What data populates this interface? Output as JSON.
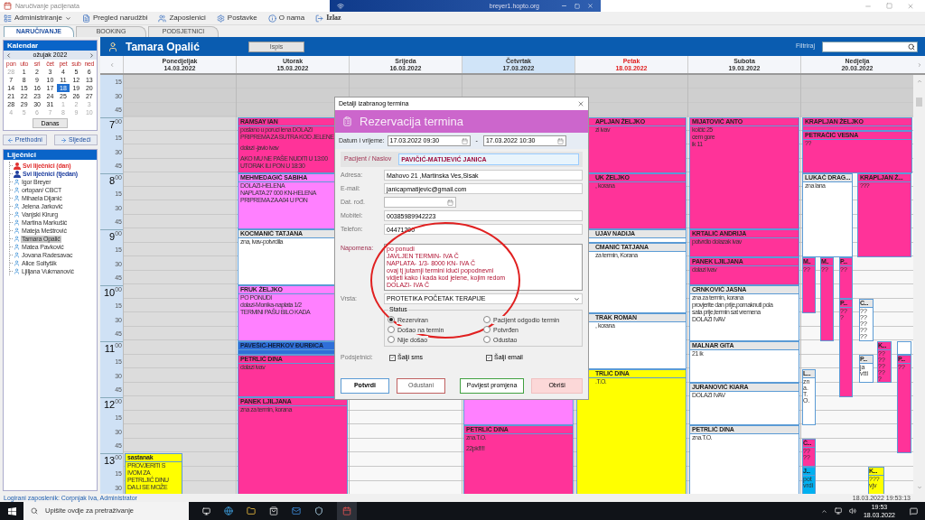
{
  "window": {
    "title": "Naručivanje pacijenata"
  },
  "remote_bar": {
    "host": "breyer1.hopto.org"
  },
  "menu": [
    {
      "label": "Administriranje",
      "kind": "dropdown"
    },
    {
      "label": "Pregled narudžbi",
      "kind": "orders"
    },
    {
      "label": "Zaposlenici",
      "kind": "staff"
    },
    {
      "label": "Postavke",
      "kind": "settings"
    },
    {
      "label": "O nama",
      "kind": "about"
    },
    {
      "label": "Izlaz",
      "kind": "exit"
    }
  ],
  "tabs": [
    {
      "label": "NARUČIVANJE",
      "selected": true
    },
    {
      "label": "BOOKING",
      "selected": false
    },
    {
      "label": "PODSJETNICI",
      "selected": false
    }
  ],
  "calendar": {
    "title": "Kalendar",
    "month": "ožujak 2022",
    "weekdays": [
      "pon",
      "uto",
      "sri",
      "čet",
      "pet",
      "sub",
      "ned"
    ],
    "today_button": "Danas",
    "days": [
      {
        "label": "28",
        "muted": true,
        "selected": false
      },
      {
        "label": "1",
        "muted": false,
        "selected": false
      },
      {
        "label": "2",
        "muted": false,
        "selected": false
      },
      {
        "label": "3",
        "muted": false,
        "selected": false
      },
      {
        "label": "4",
        "muted": false,
        "selected": false
      },
      {
        "label": "5",
        "muted": false,
        "selected": false
      },
      {
        "label": "6",
        "muted": false,
        "selected": false
      },
      {
        "label": "7",
        "muted": false,
        "selected": false
      },
      {
        "label": "8",
        "muted": false,
        "selected": false
      },
      {
        "label": "9",
        "muted": false,
        "selected": false
      },
      {
        "label": "10",
        "muted": false,
        "selected": false
      },
      {
        "label": "11",
        "muted": false,
        "selected": false
      },
      {
        "label": "12",
        "muted": false,
        "selected": false
      },
      {
        "label": "13",
        "muted": false,
        "selected": false
      },
      {
        "label": "14",
        "muted": false,
        "selected": false
      },
      {
        "label": "15",
        "muted": false,
        "selected": false
      },
      {
        "label": "16",
        "muted": false,
        "selected": false
      },
      {
        "label": "17",
        "muted": false,
        "selected": false
      },
      {
        "label": "18",
        "muted": false,
        "selected": true
      },
      {
        "label": "19",
        "muted": false,
        "selected": false
      },
      {
        "label": "20",
        "muted": false,
        "selected": false
      },
      {
        "label": "21",
        "muted": false,
        "selected": false
      },
      {
        "label": "22",
        "muted": false,
        "selected": false
      },
      {
        "label": "23",
        "muted": false,
        "selected": false
      },
      {
        "label": "24",
        "muted": false,
        "selected": false
      },
      {
        "label": "25",
        "muted": false,
        "selected": false
      },
      {
        "label": "26",
        "muted": false,
        "selected": false
      },
      {
        "label": "27",
        "muted": false,
        "selected": false
      },
      {
        "label": "28",
        "muted": false,
        "selected": false
      },
      {
        "label": "29",
        "muted": false,
        "selected": false
      },
      {
        "label": "30",
        "muted": false,
        "selected": false
      },
      {
        "label": "31",
        "muted": false,
        "selected": false
      },
      {
        "label": "1",
        "muted": true,
        "selected": false
      },
      {
        "label": "2",
        "muted": true,
        "selected": false
      },
      {
        "label": "3",
        "muted": true,
        "selected": false
      },
      {
        "label": "4",
        "muted": true,
        "selected": false
      },
      {
        "label": "5",
        "muted": true,
        "selected": false
      },
      {
        "label": "6",
        "muted": true,
        "selected": false
      },
      {
        "label": "7",
        "muted": true,
        "selected": false
      },
      {
        "label": "8",
        "muted": true,
        "selected": false
      },
      {
        "label": "9",
        "muted": true,
        "selected": false
      },
      {
        "label": "10",
        "muted": true,
        "selected": false
      }
    ]
  },
  "nav_buttons": [
    {
      "label": "Prethodni",
      "kind": "prev"
    },
    {
      "label": "Sljedeći",
      "kind": "next"
    }
  ],
  "doctors": {
    "title": "Liječnici",
    "items": [
      {
        "label": "Svi liječnici (dan)",
        "kind": "group",
        "color": "#e03030",
        "selected": false
      },
      {
        "label": "Svi liječnici (tjedan)",
        "kind": "group",
        "color": "#1f3f9f",
        "selected": false
      },
      {
        "label": "Igor Breyer",
        "kind": "doctor",
        "selected": false
      },
      {
        "label": "ortopan/ CBCT",
        "kind": "doctor",
        "selected": false
      },
      {
        "label": "Mihaela Dijanić",
        "kind": "doctor",
        "selected": false
      },
      {
        "label": "Jelena Jarković",
        "kind": "doctor",
        "selected": false
      },
      {
        "label": "Vanjski Kirurg",
        "kind": "doctor",
        "selected": false
      },
      {
        "label": "Martina Markušić",
        "kind": "doctor",
        "selected": false
      },
      {
        "label": "Mateja Meštrović",
        "kind": "doctor",
        "selected": false
      },
      {
        "label": "Tamara Opalić",
        "kind": "doctor",
        "selected": true
      },
      {
        "label": "Matea Pavković",
        "kind": "doctor",
        "selected": false
      },
      {
        "label": "Jovana Radesavac",
        "kind": "doctor",
        "selected": false
      },
      {
        "label": "Alice Soltyšik",
        "kind": "doctor",
        "selected": false
      },
      {
        "label": "Ljiljana Vukmanović",
        "kind": "doctor",
        "selected": false
      }
    ]
  },
  "schedule": {
    "person": "Tamara Opalić",
    "print_button": "Ispis",
    "filter_label": "Filtriraj",
    "time_rows": [
      {
        "label": "15",
        "kind": "quarter"
      },
      {
        "label": "30",
        "kind": "quarter"
      },
      {
        "label": "45",
        "kind": "quarter"
      },
      {
        "label": "7",
        "minutes": "00",
        "kind": "hour"
      },
      {
        "label": "15",
        "kind": "quarter"
      },
      {
        "label": "30",
        "kind": "quarter"
      },
      {
        "label": "45",
        "kind": "quarter"
      },
      {
        "label": "8",
        "minutes": "00",
        "kind": "hour"
      },
      {
        "label": "15",
        "kind": "quarter"
      },
      {
        "label": "30",
        "kind": "quarter"
      },
      {
        "label": "45",
        "kind": "quarter"
      },
      {
        "label": "9",
        "minutes": "00",
        "kind": "hour"
      },
      {
        "label": "15",
        "kind": "quarter"
      },
      {
        "label": "30",
        "kind": "quarter"
      },
      {
        "label": "45",
        "kind": "quarter"
      },
      {
        "label": "10",
        "minutes": "00",
        "kind": "hour"
      },
      {
        "label": "15",
        "kind": "quarter"
      },
      {
        "label": "30",
        "kind": "quarter"
      },
      {
        "label": "45",
        "kind": "quarter"
      },
      {
        "label": "11",
        "minutes": "00",
        "kind": "hour"
      },
      {
        "label": "15",
        "kind": "quarter"
      },
      {
        "label": "30",
        "kind": "quarter"
      },
      {
        "label": "45",
        "kind": "quarter"
      },
      {
        "label": "12",
        "minutes": "00",
        "kind": "hour"
      },
      {
        "label": "15",
        "kind": "quarter"
      },
      {
        "label": "30",
        "kind": "quarter"
      },
      {
        "label": "45",
        "kind": "quarter"
      },
      {
        "label": "13",
        "minutes": "00",
        "kind": "hour"
      },
      {
        "label": "15",
        "kind": "quarter"
      },
      {
        "label": "30",
        "kind": "quarter"
      }
    ],
    "days": [
      {
        "name": "Ponedjeljak",
        "date": "14.03.2022",
        "today": false,
        "selected": false,
        "closed": true,
        "appointments": [
          {
            "title": "sastanak",
            "color": "#ffff00",
            "paragraphs": [
              [
                "PROVJERITI S",
                "IVOM ZA",
                "PETRLJIĆ DINU",
                "DA LI SE MOŽE"
              ]
            ]
          }
        ]
      },
      {
        "name": "Utorak",
        "date": "15.03.2022",
        "today": false,
        "selected": false,
        "closed": false,
        "appointments": [
          {
            "title": "RAMSAY IAN",
            "color": "#ff3399",
            "paragraphs": [
              [
                "poslano u poruci lena DOLAZI",
                "PRIPREMA ZA SUTRA KOD JELENE"
              ],
              [
                "dolazi -javio ivav"
              ],
              [
                "AKO MU NE PAŠE NUDITI U 13:00",
                "UTORAK ILI PON U 18:30"
              ]
            ]
          },
          {
            "title": "MEHMEDAGIĆ SABIHA",
            "color": "#ff80ff",
            "paragraphs": [
              [
                "DOLAZI-HELENA",
                "NAPLATA 27 000 KN-HELENA",
                "PRIPREMA ZA A04 U PON"
              ]
            ]
          },
          {
            "title": "KOCMANIĆ TATJANA",
            "color": "#ffffff",
            "paragraphs": [
              [
                "zna, ivav-potvrdila"
              ]
            ]
          },
          {
            "title": "FRUK ŽELJKO",
            "color": "#ff80ff",
            "paragraphs": [
              [
                "PO PONUDI",
                "dolazi-Monika-naplata 1/2",
                "TERMINI PAŠU BILO KADA"
              ]
            ]
          },
          {
            "title": "PAVEŠIĆ-HERKOV ĐURĐICA",
            "color": "#2f6fd8"
          },
          {
            "title": "PETRLIĆ DINA",
            "color": "#ff3399",
            "paragraphs": [
              [
                "dolazi ivav"
              ]
            ]
          },
          {
            "title": "PANEK LJILJANA",
            "color": "#ff3399",
            "paragraphs": [
              [
                "zna za termin, korana"
              ]
            ]
          }
        ]
      },
      {
        "name": "Srijeda",
        "date": "16.03.2022",
        "today": false,
        "selected": false,
        "closed": false
      },
      {
        "name": "Četvrtak",
        "date": "17.03.2022",
        "today": false,
        "selected": true,
        "closed": false,
        "appointments": [
          {
            "color": "#ff80ff"
          },
          {
            "title": "PETRLIĆ DINA",
            "color": "#ff3399",
            "paragraphs": [
              [
                "zna.T.O."
              ],
              [
                "22pk!!!!!"
              ]
            ]
          }
        ]
      },
      {
        "name": "Petak",
        "date": "18.03.2022",
        "today": true,
        "selected": false,
        "closed": false,
        "appointments": [
          {
            "title": "APLJAN ŽELJKO",
            "color": "#ff3399",
            "paragraphs": [
              [
                "zi ivav"
              ]
            ]
          },
          {
            "title": "UK ŽELJKO",
            "color": "#ff3399",
            "paragraphs": [
              [
                ", korana"
              ]
            ]
          },
          {
            "title": "UJAV NADIJA",
            "color": "#ffffff"
          },
          {
            "title": "CMANIĆ TATJANA",
            "color": "#ffffff",
            "paragraphs": [
              [
                "za termin, Korana"
              ]
            ]
          },
          {
            "title": "TRAK ROMAN",
            "color": "#ffffff",
            "paragraphs": [
              [
                ", korana"
              ]
            ]
          },
          {
            "title": "TRLIĆ DINA",
            "color": "#ffff00",
            "paragraphs": [
              [
                ".T.O."
              ]
            ]
          }
        ]
      },
      {
        "name": "Subota",
        "date": "19.03.2022",
        "today": false,
        "selected": false,
        "closed": false,
        "appointments": [
          {
            "title": "MIJATOVIĆ ANTO",
            "color": "#ff3399",
            "paragraphs": [
              [
                "kolčić 25",
                "cem gore",
                "ik 11"
              ]
            ]
          },
          {
            "title": "KRTALIĆ ANDRIJA",
            "color": "#ff3399",
            "paragraphs": [
              [
                "potvrdio dolazak ivav"
              ]
            ]
          },
          {
            "title": "PANEK LJILJANA",
            "color": "#ff3399",
            "paragraphs": [
              [
                "dolazi ivav"
              ]
            ]
          },
          {
            "title": "CRNKOVIĆ JASNA",
            "color": "#ffffff",
            "paragraphs": [
              [
                "zna za termin, korana",
                "provjerite dan prije,pomaknuti pola",
                "sata prije,termin sat vremena",
                "DOLAZI IVAV"
              ]
            ]
          },
          {
            "title": "MALNAR GITA",
            "color": "#ffffff",
            "paragraphs": [
              [
                "21 ik"
              ]
            ]
          },
          {
            "title": "JURANOVIĆ KIARA",
            "color": "#ffffff",
            "paragraphs": [
              [
                "DOLAZI IVAV"
              ]
            ]
          },
          {
            "title": "PETRLIĆ DINA",
            "color": "#ffffff",
            "paragraphs": [
              [
                "zna.T.O."
              ]
            ]
          }
        ]
      },
      {
        "name": "Nedjelja",
        "date": "20.03.2022",
        "today": false,
        "selected": false,
        "closed": false,
        "appointments": [
          {
            "title": "KRAPLJAN ŽELJKO",
            "color": "#ff3399"
          },
          {
            "title": "PETRAČIĆ VESNA",
            "color": "#ff3399",
            "paragraphs": [
              [
                "??"
              ]
            ]
          },
          {
            "title": "LUKAČ DRAG...",
            "color": "#ffffff",
            "paragraphs": [
              [
                "zna lana"
              ]
            ]
          },
          {
            "title": "KRAPLJAN Ž...",
            "color": "#ff3399",
            "paragraphs": [
              [
                "???"
              ]
            ]
          },
          {
            "title": "M..",
            "color": "#ff3399",
            "paragraphs": [
              [
                "??"
              ]
            ]
          },
          {
            "title": "M..",
            "color": "#ff3399",
            "paragraphs": [
              [
                "??"
              ]
            ]
          },
          {
            "title": "P...",
            "color": "#ff3399",
            "paragraphs": [
              [
                "??"
              ]
            ]
          },
          {
            "title": "P...",
            "color": "#ff3399",
            "paragraphs": [
              [
                "??",
                "?"
              ]
            ]
          },
          {
            "title": "C...",
            "color": "#ffffff",
            "paragraphs": [
              [
                "??",
                "??",
                "??",
                "??",
                "??"
              ]
            ]
          },
          {
            "title": "K...",
            "color": "#ff3399",
            "paragraphs": [
              [
                "??",
                "??",
                "??",
                "??",
                "?"
              ]
            ]
          },
          {
            "color": "#ffffff"
          },
          {
            "title": "P...",
            "color": "#ffffff",
            "paragraphs": [
              [
                "ja",
                "vtti"
              ]
            ]
          },
          {
            "title": "P...",
            "color": "#ff3399",
            "paragraphs": [
              [
                "??"
              ]
            ]
          },
          {
            "title": "L...",
            "color": "#ffffff",
            "paragraphs": [
              [
                "zn",
                "a.",
                "T.",
                "O."
              ]
            ]
          },
          {
            "title": "Č...",
            "color": "#ff3399",
            "paragraphs": [
              [
                "??",
                "??"
              ]
            ]
          },
          {
            "title": "J...",
            "color": "#00b0f0",
            "paragraphs": [
              [
                "pot",
                "vrdi"
              ]
            ]
          },
          {
            "title": "K...",
            "color": "#ffff00",
            "paragraphs": [
              [
                "???",
                "vjv"
              ]
            ]
          }
        ]
      }
    ]
  },
  "dialog": {
    "title": "Detalji izabranog termina",
    "heading": "Rezervacija termina",
    "datetime_label": "Datum i vrijeme:",
    "from": {
      "date": "17.03.2022",
      "time": "09:30"
    },
    "separator": "-",
    "to": {
      "date": "17.03.2022",
      "time": "10:30"
    },
    "patient": {
      "label": "Pacijent / Naslov",
      "value": "PAVIČIĆ-MATIJEVIĆ JANICA"
    },
    "fields": [
      {
        "label": "Adresa:",
        "value": "Mahovo 21 ,Martinska Ves,Sisak",
        "kind": "text"
      },
      {
        "label": "E-mail:",
        "value": "janicapmatijevic@gmail.com",
        "kind": "text"
      },
      {
        "label": "Dat. rođ.",
        "kind": "date"
      },
      {
        "label": "Mobitel:",
        "value": "00385989942223",
        "kind": "text"
      },
      {
        "label": "Telefon:",
        "value": "04471200",
        "kind": "text"
      }
    ],
    "note": {
      "label": "Napomena:",
      "lines": [
        "po ponudi",
        "JAVLJEN TERMIN- IVA Č",
        "NAPLATA- 1/3- 8000 KN- IVA Č",
        "ovaj tj jutarnji termini idući popodnevni",
        "vidjeti kako i kada kod jelene, kojim redom",
        "DOLAZI- IVA Č"
      ]
    },
    "type": {
      "label": "Vrsta:",
      "value": "PROTETIKA POČETAK TERAPIJE"
    },
    "status": {
      "label": "Status",
      "options": [
        {
          "label": "Rezerviran",
          "selected": true
        },
        {
          "label": "Pacijent odgodio termin",
          "selected": false
        },
        {
          "label": "Došao na termin",
          "selected": false
        },
        {
          "label": "Potvrđen",
          "selected": false
        },
        {
          "label": "Nije došao",
          "selected": false
        },
        {
          "label": "Odustao",
          "selected": false
        }
      ]
    },
    "reminders": {
      "label": "Podsjetnici:",
      "options": [
        {
          "label": "Šalji sms",
          "checked": true
        },
        {
          "label": "Šalji email",
          "checked": true
        }
      ]
    },
    "buttons": [
      {
        "label": "Potvrdi",
        "kind": "confirm"
      },
      {
        "label": "Odustani",
        "kind": "cancel"
      },
      {
        "label": "Povijest promjena",
        "kind": "history"
      },
      {
        "label": "Obriši",
        "kind": "delete"
      }
    ]
  },
  "status_bar": {
    "user": "Logirani zaposlenik: Corpnjak Iva, Administrator",
    "timestamp": "18.03.2022 19:53:13"
  },
  "taskbar": {
    "search_placeholder": "Upišite ovdje za pretraživanje",
    "time": "19:53",
    "date": "18.03.2022"
  }
}
